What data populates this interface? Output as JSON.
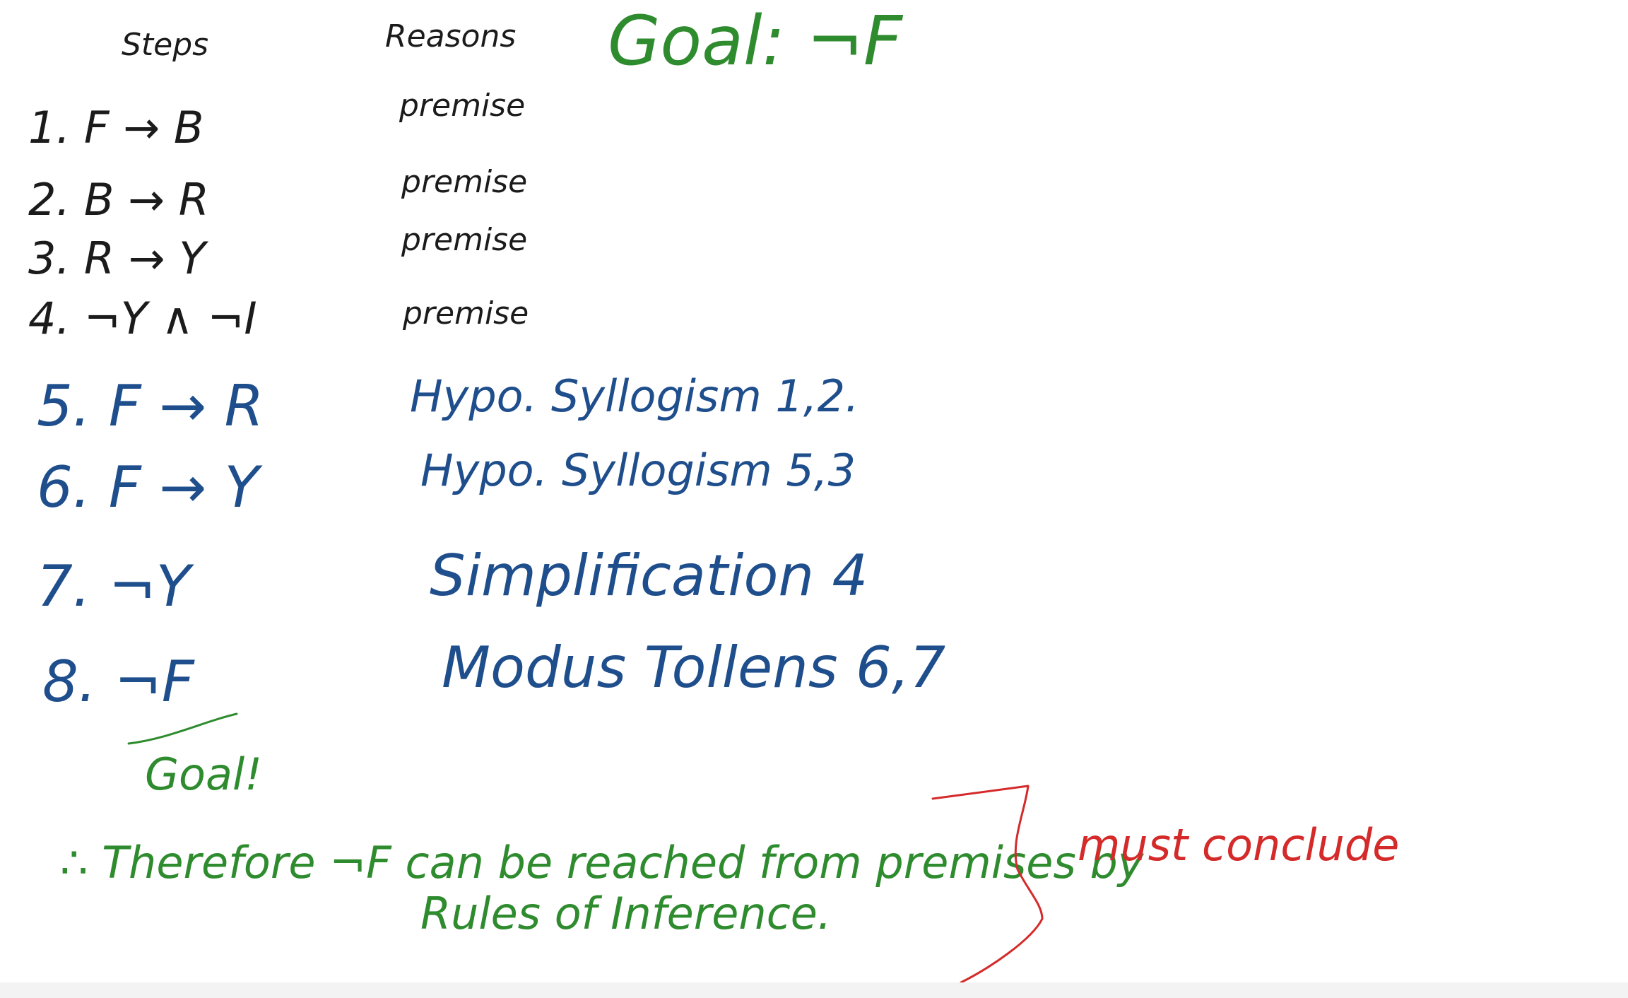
{
  "headers": {
    "steps": "Steps",
    "reasons": "Reasons",
    "goal_top": "Goal: ¬F"
  },
  "steps": [
    {
      "label": "1. F → B",
      "reason": "premise"
    },
    {
      "label": "2. B → R",
      "reason": "premise"
    },
    {
      "label": "3. R → Y",
      "reason": "premise"
    },
    {
      "label": "4. ¬Y ∧ ¬I",
      "reason": "premise"
    },
    {
      "label": "5. F → R",
      "reason": "Hypo. Syllogism 1,2."
    },
    {
      "label": "6. F → Y",
      "reason": "Hypo. Syllogism 5,3"
    },
    {
      "label": "7. ¬Y",
      "reason": "Simplification 4"
    },
    {
      "label": "8. ¬F",
      "reason": "Modus Tollens 6,7"
    }
  ],
  "goal_under": "Goal!",
  "conclusion": {
    "line1": "∴ Therefore ¬F can be reached from premises by",
    "line2": "Rules of Inference."
  },
  "annotation": "must conclude",
  "colors": {
    "black": "#1b1b1b",
    "blue": "#1f4e8c",
    "green": "#2e8b2e",
    "red": "#d42a2a"
  }
}
